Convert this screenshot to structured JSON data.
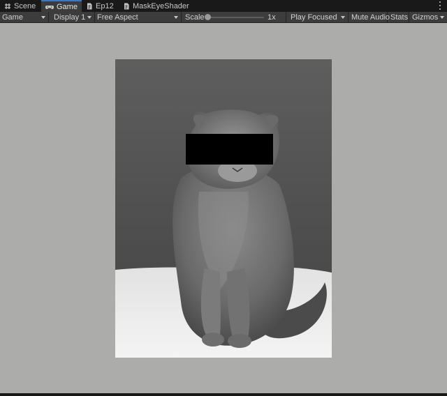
{
  "tabs": [
    {
      "label": "Scene",
      "icon": "grid-icon",
      "active": false
    },
    {
      "label": "Game",
      "icon": "gamepad-icon",
      "active": true
    },
    {
      "label": "Ep12",
      "icon": "shader-file-icon",
      "active": false
    },
    {
      "label": "MaskEyeShader",
      "icon": "shader-file-icon",
      "active": false
    }
  ],
  "toolbar": {
    "mode": "Game",
    "display": "Display 1",
    "aspect": "Free Aspect",
    "scale_label": "Scale",
    "scale_value": "1x",
    "play_mode": "Play Focused",
    "mute_audio": "Mute Audio",
    "stats": "Stats",
    "gizmos": "Gizmos"
  },
  "viewport": {
    "background": "#acacab",
    "content": "grey cat photo with black eye-mask bar"
  },
  "colors": {
    "accent": "#3a79bb",
    "toolbar": "#3c3c3c",
    "mask": "#000000"
  }
}
